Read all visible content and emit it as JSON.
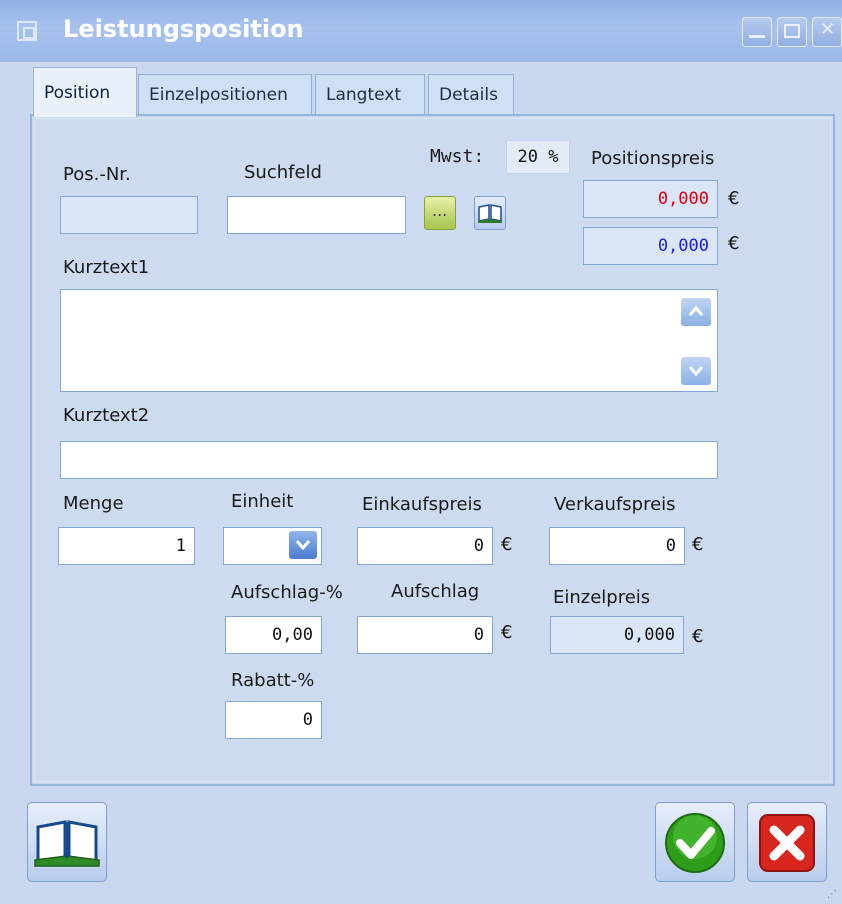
{
  "window": {
    "title": "Leistungsposition"
  },
  "tabs": [
    {
      "label": "Position",
      "active": true
    },
    {
      "label": "Einzelpositionen",
      "active": false
    },
    {
      "label": "Langtext",
      "active": false
    },
    {
      "label": "Details",
      "active": false
    }
  ],
  "form": {
    "pos_nr_label": "Pos.-Nr.",
    "pos_nr_value": "",
    "suchfeld_label": "Suchfeld",
    "suchfeld_value": "",
    "mwst_label": "Mwst:",
    "mwst_value": "20 %",
    "positionspreis_label": "Positionspreis",
    "positionspreis_value1": "0,000",
    "positionspreis_value2": "0,000",
    "currency": "€",
    "browse_button_label": "...",
    "kurztext1_label": "Kurztext1",
    "kurztext1_value": "",
    "kurztext2_label": "Kurztext2",
    "kurztext2_value": "",
    "menge_label": "Menge",
    "menge_value": "1",
    "einheit_label": "Einheit",
    "einheit_value": "",
    "einkaufspreis_label": "Einkaufspreis",
    "einkaufspreis_value": "0",
    "verkaufspreis_label": "Verkaufspreis",
    "verkaufspreis_value": "0",
    "aufschlag_pct_label": "Aufschlag-%",
    "aufschlag_pct_value": "0,00",
    "aufschlag_label": "Aufschlag",
    "aufschlag_value": "0",
    "einzelpreis_label": "Einzelpreis",
    "einzelpreis_value": "0,000",
    "rabatt_pct_label": "Rabatt-%",
    "rabatt_pct_value": "0"
  },
  "colors": {
    "positionspreis_value1": "#e00010",
    "positionspreis_value2": "#1c1cdd",
    "confirm": "#2e9e1a",
    "cancel": "#d7261d"
  },
  "icons": [
    "window-icon",
    "minimize-icon",
    "maximize-icon",
    "close-icon",
    "book-icon",
    "scroll-up-icon",
    "scroll-down-icon",
    "dropdown-arrow-icon",
    "checkmark-icon",
    "cancel-x-icon"
  ]
}
